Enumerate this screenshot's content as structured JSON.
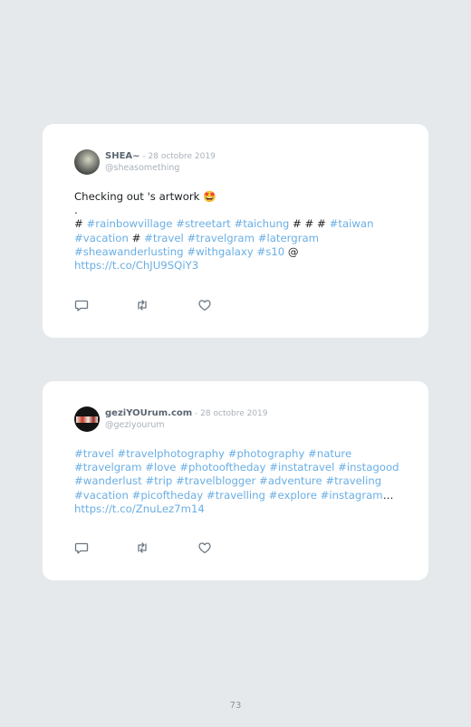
{
  "tweets": [
    {
      "author": {
        "name": "SHEA~",
        "handle": "@sheasomething"
      },
      "separator": " - ",
      "date": "28 octobre 2019",
      "lines": [
        [
          {
            "t": "Checking out 's artwork "
          },
          {
            "t": "🤩",
            "k": "emoji"
          }
        ],
        [
          {
            "t": "."
          }
        ],
        [
          {
            "t": "# "
          },
          {
            "t": "#rainbowvillage",
            "k": "tag"
          },
          {
            "t": " "
          },
          {
            "t": "#streetart",
            "k": "tag"
          },
          {
            "t": " "
          },
          {
            "t": "#taichung",
            "k": "tag"
          },
          {
            "t": " # # # "
          },
          {
            "t": "#taiwan",
            "k": "tag"
          }
        ],
        [
          {
            "t": "#vacation",
            "k": "tag"
          },
          {
            "t": " # "
          },
          {
            "t": "#travel",
            "k": "tag"
          },
          {
            "t": " "
          },
          {
            "t": "#travelgram",
            "k": "tag"
          },
          {
            "t": " "
          },
          {
            "t": "#latergram",
            "k": "tag"
          }
        ],
        [
          {
            "t": "#sheawanderlusting",
            "k": "tag"
          },
          {
            "t": " "
          },
          {
            "t": "#withgalaxy",
            "k": "tag"
          },
          {
            "t": " "
          },
          {
            "t": "#s10",
            "k": "tag"
          },
          {
            "t": " @"
          }
        ],
        [
          {
            "t": "https://t.co/ChJU9SQiY3",
            "k": "tag"
          }
        ]
      ],
      "avatar_icon": "profile-photo-icon"
    },
    {
      "author": {
        "name": "geziYOUrum.com",
        "handle": "@geziyourum"
      },
      "separator": " - ",
      "date": "28 octobre 2019",
      "lines": [
        [
          {
            "t": "#travel",
            "k": "tag"
          },
          {
            "t": " "
          },
          {
            "t": "#travelphotography",
            "k": "tag"
          },
          {
            "t": " "
          },
          {
            "t": "#photography",
            "k": "tag"
          },
          {
            "t": " "
          },
          {
            "t": "#nature",
            "k": "tag"
          }
        ],
        [
          {
            "t": "#travelgram",
            "k": "tag"
          },
          {
            "t": " "
          },
          {
            "t": "#love",
            "k": "tag"
          },
          {
            "t": " "
          },
          {
            "t": "#photooftheday",
            "k": "tag"
          },
          {
            "t": " "
          },
          {
            "t": "#instatravel",
            "k": "tag"
          },
          {
            "t": " "
          },
          {
            "t": "#instagood",
            "k": "tag"
          }
        ],
        [
          {
            "t": "#wanderlust",
            "k": "tag"
          },
          {
            "t": " "
          },
          {
            "t": "#trip",
            "k": "tag"
          },
          {
            "t": " "
          },
          {
            "t": "#travelblogger",
            "k": "tag"
          },
          {
            "t": " "
          },
          {
            "t": "#adventure",
            "k": "tag"
          },
          {
            "t": " "
          },
          {
            "t": "#traveling",
            "k": "tag"
          }
        ],
        [
          {
            "t": "#vacation",
            "k": "tag"
          },
          {
            "t": " "
          },
          {
            "t": "#picoftheday",
            "k": "tag"
          },
          {
            "t": " "
          },
          {
            "t": "#travelling",
            "k": "tag"
          },
          {
            "t": " "
          },
          {
            "t": "#explore",
            "k": "tag"
          },
          {
            "t": " "
          },
          {
            "t": "#instagram",
            "k": "tag"
          },
          {
            "t": "…"
          }
        ],
        [
          {
            "t": "https://t.co/ZnuLez7m14",
            "k": "tag"
          }
        ]
      ],
      "avatar_icon": "profile-photo-icon"
    }
  ],
  "action_icons": [
    "reply-icon",
    "retweet-icon",
    "like-icon"
  ],
  "colors": {
    "background": "#e6e9ec",
    "card": "#ffffff",
    "link": "#6aaee3",
    "muted": "#a9b1b9",
    "name": "#5b6570",
    "text": "#1c1f22"
  },
  "page_number": "73"
}
